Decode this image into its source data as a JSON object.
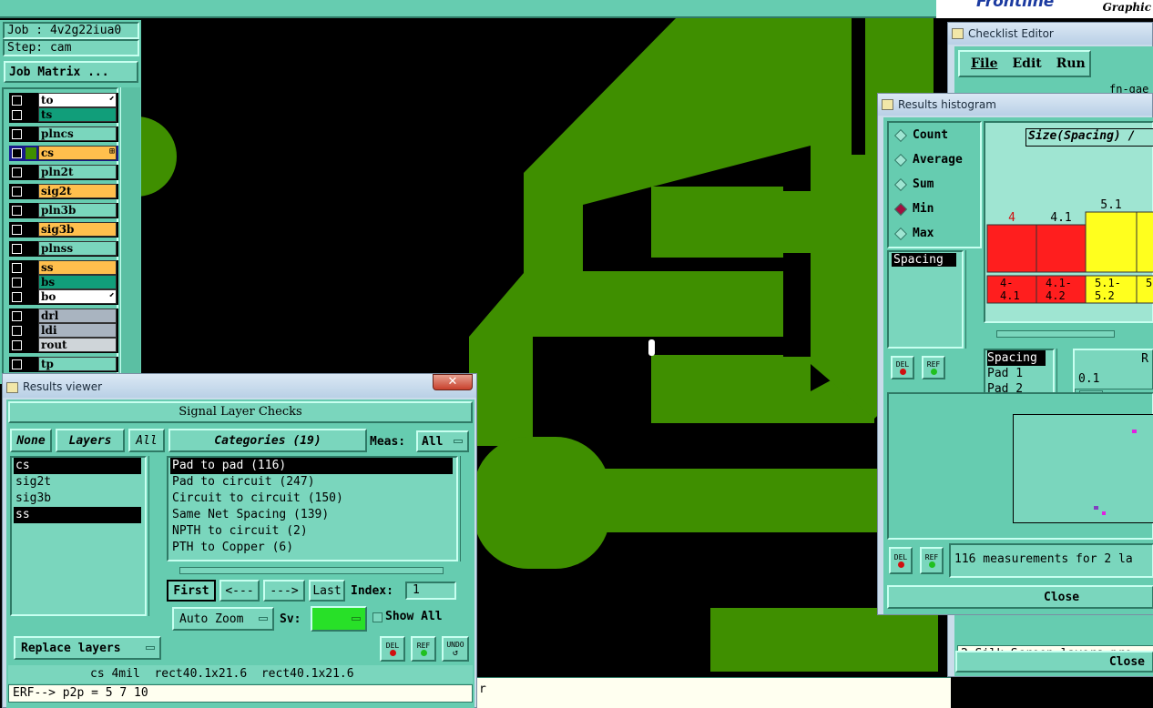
{
  "top_banner": {
    "brand": "Frontline",
    "sub": "Graphic"
  },
  "job_panel": {
    "job": "Job : 4v2g22iua0",
    "step": "Step: cam",
    "matrix_button": "Job Matrix ..."
  },
  "layers": [
    {
      "name": "to",
      "color": "#ffffff",
      "mark": "⬋"
    },
    {
      "name": "ts",
      "color": "#119e7a",
      "mark": ""
    },
    {
      "name": "plncs",
      "color": "#7ad6bd",
      "mark": ""
    },
    {
      "name": "cs",
      "color": "#ffbf4d",
      "mark": "⊞"
    },
    {
      "name": "pln2t",
      "color": "#7ad6bd",
      "mark": ""
    },
    {
      "name": "sig2t",
      "color": "#ffbf4d",
      "mark": ""
    },
    {
      "name": "pln3b",
      "color": "#7ad6bd",
      "mark": ""
    },
    {
      "name": "sig3b",
      "color": "#ffbf4d",
      "mark": ""
    },
    {
      "name": "plnss",
      "color": "#7ad6bd",
      "mark": ""
    },
    {
      "name": "ss",
      "color": "#ffbf4d",
      "mark": ""
    },
    {
      "name": "bs",
      "color": "#119e7a",
      "mark": ""
    },
    {
      "name": "bo",
      "color": "#ffffff",
      "mark": "⬋"
    },
    {
      "name": "drl",
      "color": "#a9b4c0",
      "mark": ""
    },
    {
      "name": "ldi",
      "color": "#a9b4c0",
      "mark": ""
    },
    {
      "name": "rout",
      "color": "#cfd5d9",
      "mark": ""
    },
    {
      "name": "tp",
      "color": "#7ad6bd",
      "mark": ""
    }
  ],
  "results_viewer": {
    "title": "Results viewer",
    "header": "Signal Layer Checks",
    "none_btn": "None",
    "layers_btn": "Layers",
    "all_btn": "All",
    "categories_btn": "Categories (19)",
    "meas_label": "Meas:",
    "meas_value": "All",
    "layer_list": [
      "cs",
      "sig2t",
      "sig3b",
      "ss"
    ],
    "categories": [
      "Pad to pad (116)",
      "Pad to circuit (247)",
      "Circuit to circuit (150)",
      "Same Net Spacing (139)",
      "NPTH to circuit (2)",
      "PTH to Copper (6)"
    ],
    "first_btn": "First",
    "prev_btn": "<---",
    "next_btn": "--->",
    "last_btn": "Last",
    "index_label": "Index:",
    "index_value": "1",
    "autozoom_btn": "Auto Zoom",
    "sv_label": "Sv:",
    "show_all": "Show All",
    "replace_btn": "Replace layers",
    "del": "DEL",
    "ref": "REF",
    "undo": "UNDO",
    "status": "cs 4mil  rect40.1x21.6  rect40.1x21.6",
    "erf": "ERF--> p2p = 5 7 10"
  },
  "checklist_editor": {
    "title": "Checklist Editor",
    "menu": [
      "File",
      "Edit",
      "Run"
    ],
    "fn_label": "fn-gae",
    "status_line": "2 Silk Screen layers pro",
    "close": "Close"
  },
  "histogram": {
    "title": "Results histogram",
    "options": [
      "Count",
      "Average",
      "Sum",
      "Min",
      "Max"
    ],
    "selected": "Min",
    "spacing_list": [
      "Spacing"
    ],
    "chart_title": "Size(Spacing) /",
    "bar_labels": [
      "4",
      "4.1",
      "5.1"
    ],
    "bins": [
      "4-\n4.1",
      "4.1-\n4.2",
      "5.1-\n5.2",
      "5"
    ],
    "info_lines": [
      "Spacing",
      "Pad 1",
      "Pad 2"
    ],
    "r_label": "R",
    "value_label": "0.1",
    "del": "DEL",
    "ref": "REF",
    "measurements": "116 measurements for 2 la",
    "close": "Close"
  }
}
